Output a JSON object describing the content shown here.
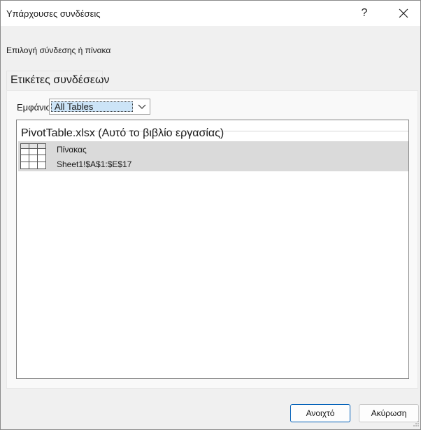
{
  "window": {
    "title": "Υπάρχουσες συνδέσεις",
    "help_label": "?"
  },
  "subtitle": "Επιλογή σύνδεσης ή πίνακα",
  "tab": {
    "label": "Ετικέτες συνδέσεων"
  },
  "filter": {
    "label": "Εμφάνιση:",
    "value": "All Tables"
  },
  "list": {
    "group_header": "PivotTable.xlsx (Αυτό το βιβλίο εργασίας)",
    "items": [
      {
        "name": "Πίνακας",
        "range": "Sheet1!$A$1:$E$17",
        "icon": "table-icon"
      }
    ]
  },
  "buttons": {
    "open": "Ανοιχτό",
    "cancel": "Ακύρωση"
  }
}
